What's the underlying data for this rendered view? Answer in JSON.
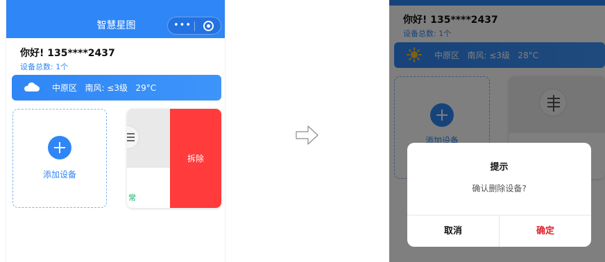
{
  "left_screen": {
    "nav": {
      "title": "智慧星图",
      "more_glyph": "•••"
    },
    "greeting": "你好! 135****2437",
    "device_count": "设备总数: 1个",
    "weather": {
      "text": "中原区   南风: ≤3级   29°C",
      "icon": "cloud-icon"
    },
    "add_device_label": "添加设备",
    "device_card": {
      "status_fragment": "常",
      "remove_label": "拆除"
    }
  },
  "right_screen": {
    "greeting": "你好! 135****2437",
    "device_count": "设备总数: 1个",
    "weather": {
      "text": "中原区   南风: ≤3级   28°C",
      "icon": "sun-icon"
    },
    "add_device_label": "添加设备",
    "dialog": {
      "title": "提示",
      "message": "确认删除设备?",
      "cancel_label": "取消",
      "confirm_label": "确定"
    }
  },
  "colors": {
    "primary": "#2f86f6",
    "danger": "#ff3b3b",
    "confirm": "#e0202a",
    "status_green": "#19b36b"
  }
}
